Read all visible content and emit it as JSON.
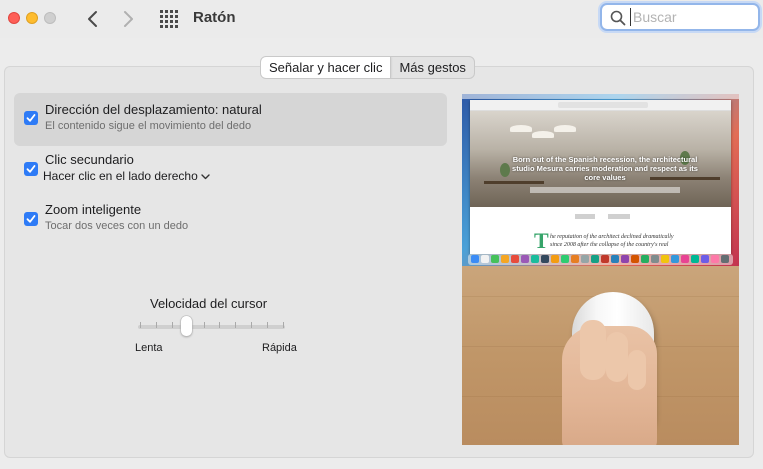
{
  "window": {
    "title": "Ratón"
  },
  "search": {
    "placeholder": "Buscar",
    "value": ""
  },
  "tabs": [
    {
      "label": "Señalar y hacer clic",
      "active": true
    },
    {
      "label": "Más gestos",
      "active": false
    }
  ],
  "options": [
    {
      "title": "Dirección del desplazamiento: natural",
      "subtitle": "El contenido sigue el movimiento del dedo",
      "checked": true,
      "selected": true
    },
    {
      "title": "Clic secundario",
      "dropdown_value": "Hacer clic en el lado derecho",
      "checked": true,
      "selected": false
    },
    {
      "title": "Zoom inteligente",
      "subtitle": "Tocar dos veces con un dedo",
      "checked": true,
      "selected": false
    }
  ],
  "cursor_speed": {
    "label": "Velocidad del cursor",
    "min_label": "Lenta",
    "max_label": "Rápida",
    "value_fraction": 0.33,
    "ticks": 10
  },
  "preview": {
    "headline": "Born out of the Spanish recession, the architectural studio Mesura carries moderation and respect as its core values",
    "dropcap": "T",
    "article_text": "he reputation of the architect declined dramatically since 2008 after the collapse of the country's real"
  },
  "colors": {
    "accent": "#2e7bf6",
    "search_focus": "#93b6ea",
    "close": "#fe5f57",
    "minimize": "#febc2e"
  },
  "icons": {
    "back": "chevron-left-icon",
    "forward": "chevron-right-icon",
    "grid": "grid-icon",
    "search": "magnifier-icon",
    "checkbox": "checkmark-icon"
  }
}
